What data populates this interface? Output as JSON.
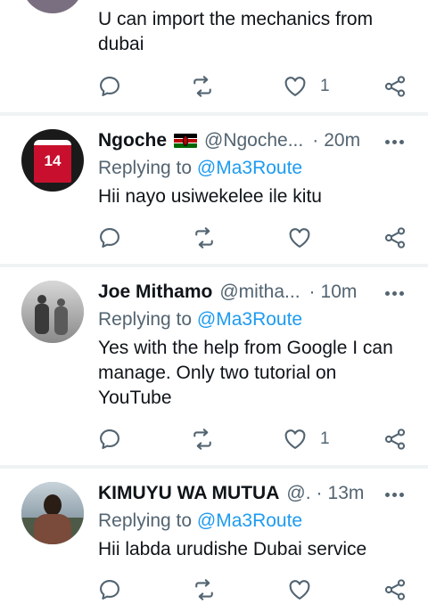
{
  "tweets": [
    {
      "text": "U can import the mechanics from dubai",
      "like_count": "1"
    },
    {
      "name": "Ngoche",
      "handle": "@Ngoche...",
      "time": "20m",
      "replying_label": "Replying to",
      "mention": "@Ma3Route",
      "text": "Hii nayo usiwekelee ile kitu"
    },
    {
      "name": "Joe Mithamo",
      "handle": "@mitha...",
      "time": "10m",
      "replying_label": "Replying to",
      "mention": "@Ma3Route",
      "text": "Yes with the help from Google I can manage. Only two tutorial on YouTube",
      "like_count": "1"
    },
    {
      "name": "KIMUYU WA MUTUA",
      "handle": "@.",
      "time": "13m",
      "replying_label": "Replying to",
      "mention": "@Ma3Route",
      "text": "Hii labda urudishe Dubai service"
    }
  ],
  "separator": "·",
  "jersey_number": "14",
  "icons": [
    "reply-icon",
    "retweet-icon",
    "like-icon",
    "share-icon",
    "more-icon"
  ],
  "colors": {
    "muted": "#536471",
    "mention": "#1d9bf0",
    "divider": "#eff3f4",
    "text": "#0f1419"
  }
}
